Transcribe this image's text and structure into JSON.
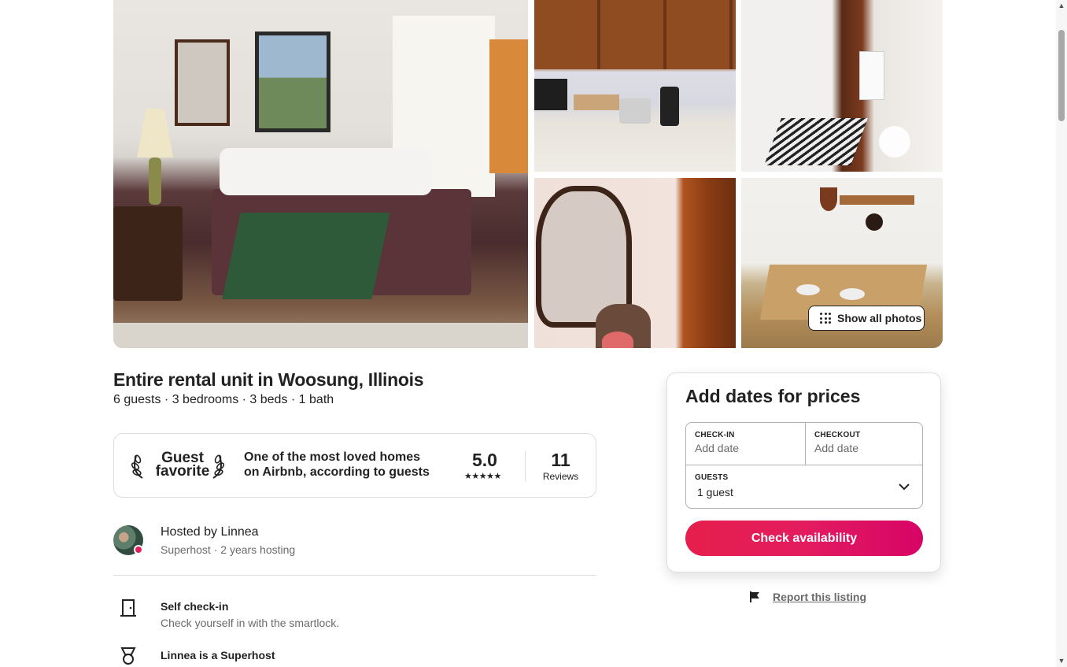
{
  "photos": {
    "show_all_label": "Show all photos",
    "items": [
      "bedroom-photo",
      "kitchen-photo",
      "bathroom-photo",
      "mirror-photo",
      "dining-photo"
    ]
  },
  "listing": {
    "title": "Entire rental unit in Woosung, Illinois",
    "subtitle": "6 guests · 3 bedrooms · 3 beds · 1 bath"
  },
  "guest_favorite": {
    "label_line1": "Guest",
    "label_line2": "favorite",
    "description": "One of the most loved homes on Airbnb, according to guests",
    "rating": "5.0",
    "stars": "★★★★★",
    "stars_value": 5,
    "reviews_count": "11",
    "reviews_label": "Reviews"
  },
  "host": {
    "name_line": "Hosted by Linnea",
    "meta": "Superhost · 2 years hosting"
  },
  "highlights": [
    {
      "icon": "door-icon",
      "title": "Self check-in",
      "desc": "Check yourself in with the smartlock."
    },
    {
      "icon": "medal-icon",
      "title": "Linnea is a Superhost",
      "desc": ""
    }
  ],
  "booking": {
    "title": "Add dates for prices",
    "checkin_label": "CHECK-IN",
    "checkin_value": "Add date",
    "checkout_label": "CHECKOUT",
    "checkout_value": "Add date",
    "guests_label": "GUESTS",
    "guests_value": "1 guest",
    "button_label": "Check availability",
    "accent_color": "#e31c5f"
  },
  "report": {
    "label": "Report this listing"
  }
}
